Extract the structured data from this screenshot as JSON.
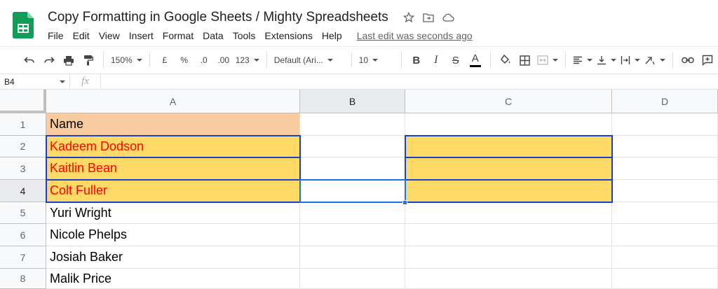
{
  "app": {
    "doc_title": "Copy Formatting in Google Sheets / Mighty Spreadsheets",
    "last_edit": "Last edit was seconds ago",
    "menu": [
      "File",
      "Edit",
      "View",
      "Insert",
      "Format",
      "Data",
      "Tools",
      "Extensions",
      "Help"
    ]
  },
  "toolbar": {
    "zoom": "150%",
    "currency": "£",
    "percent": "%",
    "decrease_decimal": ".0",
    "increase_decimal": ".00",
    "number_format": "123",
    "font": "Default (Ari...",
    "font_size": "10",
    "bold": "B",
    "italic": "I",
    "strikethrough": "S",
    "text_color_letter": "A"
  },
  "formula_bar": {
    "name_box": "B4",
    "fx": "fx"
  },
  "grid": {
    "columns": [
      "A",
      "B",
      "C",
      "D"
    ],
    "rows": [
      "1",
      "2",
      "3",
      "4",
      "5",
      "6",
      "7",
      "8"
    ],
    "column_a": [
      "Name",
      "Kadeem Dodson",
      "Kaitlin Bean",
      "Colt Fuller",
      "Yuri Wright",
      "Nicole Phelps",
      "Josiah Baker",
      "Malik Price"
    ],
    "active_cell": "B4"
  },
  "colors": {
    "header_fill": "#f8cba0",
    "highlight_fill": "#ffd966",
    "red_text": "#ff0000",
    "selection_border": "#1a3fc9",
    "active_border": "#1a73e8",
    "sheets_green": "#0f9d58"
  }
}
